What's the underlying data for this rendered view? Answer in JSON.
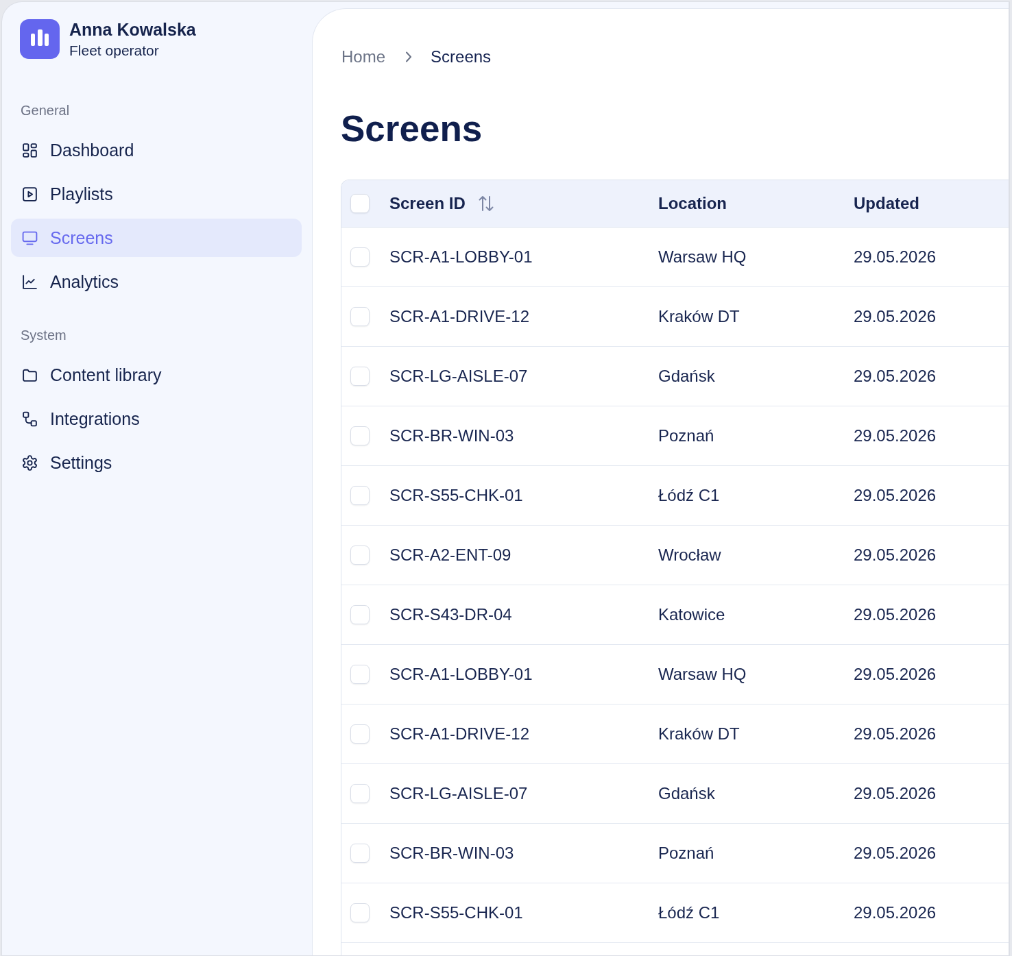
{
  "user": {
    "name": "Anna Kowalska",
    "role": "Fleet operator"
  },
  "sidebar": {
    "sections": [
      {
        "title": "General",
        "items": [
          {
            "label": "Dashboard",
            "selected": false
          },
          {
            "label": "Playlists",
            "selected": false
          },
          {
            "label": "Screens",
            "selected": true
          },
          {
            "label": "Analytics",
            "selected": false
          }
        ]
      },
      {
        "title": "System",
        "items": [
          {
            "label": "Content library",
            "selected": false
          },
          {
            "label": "Integrations",
            "selected": false
          },
          {
            "label": "Settings",
            "selected": false
          }
        ]
      }
    ]
  },
  "breadcrumb": [
    {
      "label": "Home",
      "current": false
    },
    {
      "label": "Screens",
      "current": true
    }
  ],
  "page_title": "Screens",
  "table": {
    "select_all": {
      "checked": false
    },
    "columns": [
      {
        "label": "Screen ID",
        "sortable": true
      },
      {
        "label": "Location",
        "sortable": false
      },
      {
        "label": "Updated",
        "sortable": false
      }
    ],
    "rows": [
      {
        "checked": false,
        "cells": [
          "SCR-A1-LOBBY-01",
          "Warsaw HQ",
          "29.05.2026"
        ]
      },
      {
        "checked": false,
        "cells": [
          "SCR-A1-DRIVE-12",
          "Kraków DT",
          "29.05.2026"
        ]
      },
      {
        "checked": false,
        "cells": [
          "SCR-LG-AISLE-07",
          "Gdańsk",
          "29.05.2026"
        ]
      },
      {
        "checked": false,
        "cells": [
          "SCR-BR-WIN-03",
          "Poznań",
          "29.05.2026"
        ]
      },
      {
        "checked": false,
        "cells": [
          "SCR-S55-CHK-01",
          "Łódź C1",
          "29.05.2026"
        ]
      },
      {
        "checked": false,
        "cells": [
          "SCR-A2-ENT-09",
          "Wrocław",
          "29.05.2026"
        ]
      },
      {
        "checked": false,
        "cells": [
          "SCR-S43-DR-04",
          "Katowice",
          "29.05.2026"
        ]
      },
      {
        "checked": false,
        "cells": [
          "SCR-A1-LOBBY-01",
          "Warsaw HQ",
          "29.05.2026"
        ]
      },
      {
        "checked": false,
        "cells": [
          "SCR-A1-DRIVE-12",
          "Kraków DT",
          "29.05.2026"
        ]
      },
      {
        "checked": false,
        "cells": [
          "SCR-LG-AISLE-07",
          "Gdańsk",
          "29.05.2026"
        ]
      },
      {
        "checked": false,
        "cells": [
          "SCR-BR-WIN-03",
          "Poznań",
          "29.05.2026"
        ]
      },
      {
        "checked": false,
        "cells": [
          "SCR-S55-CHK-01",
          "Łódź C1",
          "29.05.2026"
        ]
      }
    ]
  }
}
